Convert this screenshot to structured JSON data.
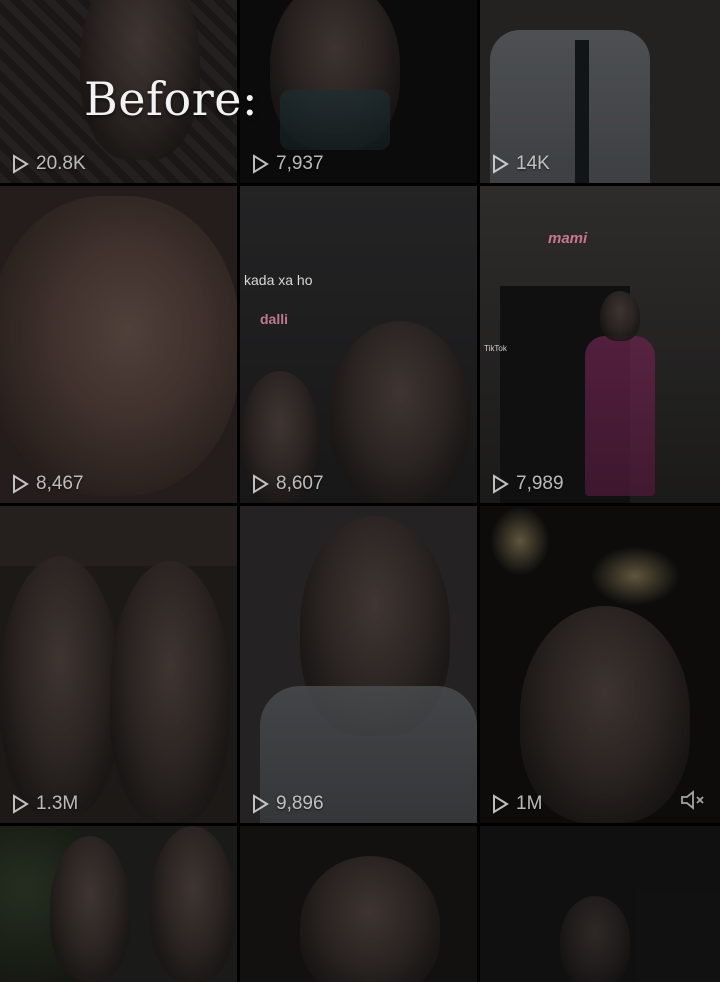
{
  "overlay_title": "Before:",
  "tiles": [
    {
      "views": "20.8K"
    },
    {
      "views": "7,937"
    },
    {
      "views": "14K"
    },
    {
      "views": "8,467"
    },
    {
      "views": "8,607",
      "caption_top": "kada xa ho",
      "caption_sticker": "dalli"
    },
    {
      "views": "7,989",
      "caption_top": "mami",
      "watermark_label": "TikTok"
    },
    {
      "views": "1.3M"
    },
    {
      "views": "9,896"
    },
    {
      "views": "1M"
    },
    {
      "views": ""
    },
    {
      "views": ""
    },
    {
      "views": ""
    }
  ],
  "icons": {
    "play": "play-icon",
    "mute": "muted-speaker-icon"
  },
  "colors": {
    "background": "#000000",
    "view_text": "#ebebeb",
    "sticker_pink": "#ff6fa0"
  }
}
